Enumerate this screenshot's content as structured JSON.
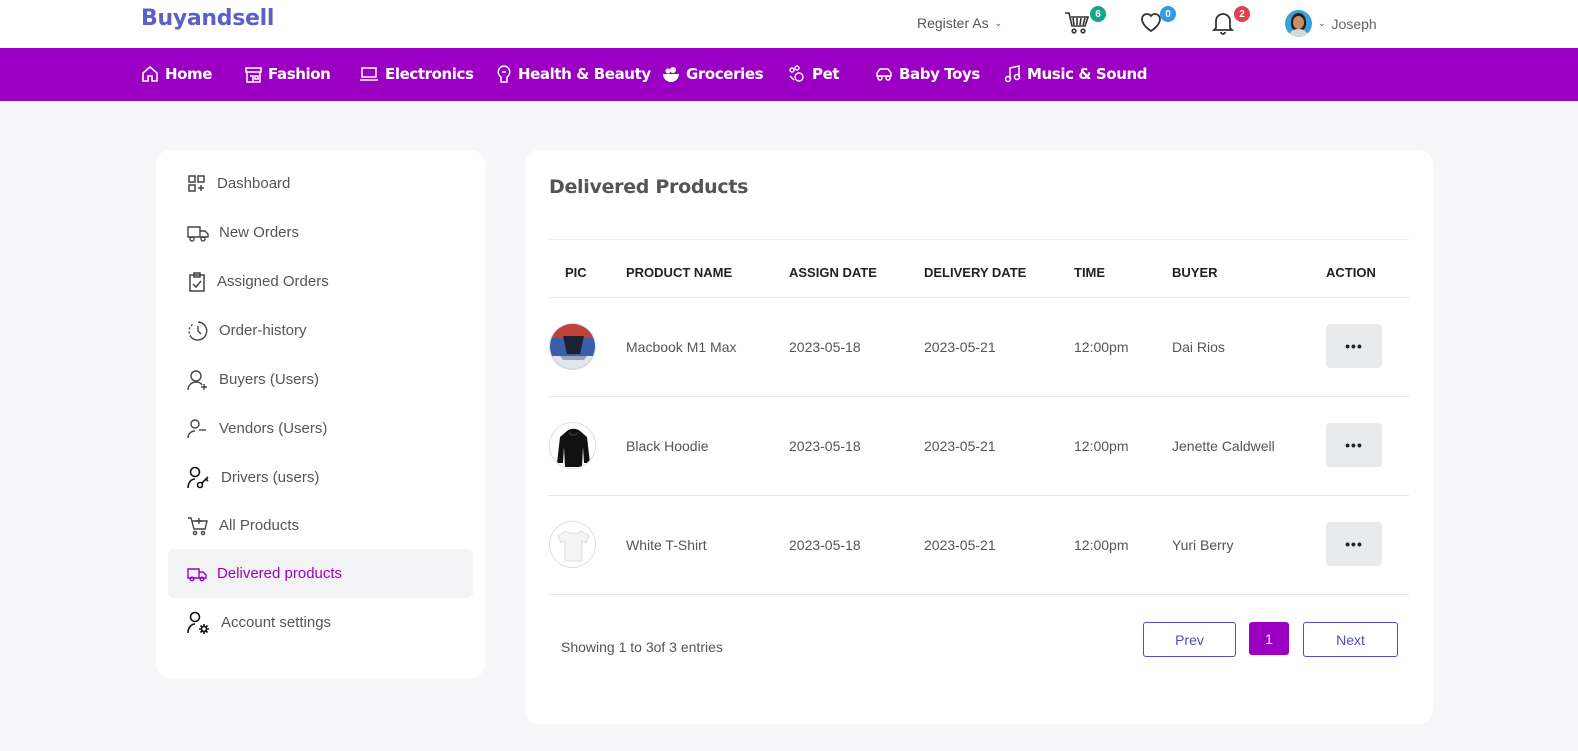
{
  "header": {
    "brand": "Buyandsell",
    "register_label": "Register As",
    "cart_count": "6",
    "wishlist_count": "0",
    "notifications_count": "2",
    "user_name": "Joseph"
  },
  "categories": [
    {
      "label": "Home",
      "icon": "home-icon"
    },
    {
      "label": "Fashion",
      "icon": "store-icon"
    },
    {
      "label": "Electronics",
      "icon": "laptop-icon"
    },
    {
      "label": "Health & Beauty",
      "icon": "beauty-icon"
    },
    {
      "label": "Groceries",
      "icon": "grocery-bowl-icon"
    },
    {
      "label": "Pet",
      "icon": "pet-icon"
    },
    {
      "label": "Baby Toys",
      "icon": "toy-car-icon"
    },
    {
      "label": "Music & Sound",
      "icon": "music-note-icon"
    }
  ],
  "sidebar": {
    "items": [
      {
        "label": "Dashboard",
        "icon": "dashboard-icon"
      },
      {
        "label": "New Orders",
        "icon": "truck-icon"
      },
      {
        "label": "Assigned Orders",
        "icon": "clipboard-check-icon"
      },
      {
        "label": "Order-history",
        "icon": "history-icon"
      },
      {
        "label": "Buyers (Users)",
        "icon": "user-plus-icon"
      },
      {
        "label": "Vendors (Users)",
        "icon": "user-minus-icon"
      },
      {
        "label": "Drivers (users)",
        "icon": "user-key-icon"
      },
      {
        "label": "All Products",
        "icon": "cart-icon"
      },
      {
        "label": "Delivered products",
        "icon": "delivery-truck-icon",
        "active": true
      },
      {
        "label": "Account settings",
        "icon": "user-gear-icon"
      }
    ]
  },
  "main": {
    "title": "Delivered Products",
    "columns": [
      "PIC",
      "PRODUCT NAME",
      "ASSIGN DATE",
      "DELIVERY DATE",
      "TIME",
      "BUYER",
      "ACTION"
    ],
    "rows": [
      {
        "product": "Macbook M1 Max",
        "assign_date": "2023-05-18",
        "delivery_date": "2023-05-21",
        "time": "12:00pm",
        "buyer": "Dai Rios",
        "action": "•••"
      },
      {
        "product": "Black Hoodie",
        "assign_date": "2023-05-18",
        "delivery_date": "2023-05-21",
        "time": "12:00pm",
        "buyer": "Jenette Caldwell",
        "action": "•••"
      },
      {
        "product": "White T-Shirt",
        "assign_date": "2023-05-18",
        "delivery_date": "2023-05-21",
        "time": "12:00pm",
        "buyer": "Yuri Berry",
        "action": "•••"
      }
    ],
    "showing": "Showing 1 to 3of 3 entries",
    "pagination": {
      "prev": "Prev",
      "page": "1",
      "next": "Next"
    }
  },
  "colors": {
    "brand": "#5b5fc7",
    "nav_bg": "#9b00c2",
    "active": "#9b00c2",
    "cart_badge": "#17a589",
    "wishlist_badge": "#2e9be6",
    "notify_badge": "#e0404f"
  }
}
